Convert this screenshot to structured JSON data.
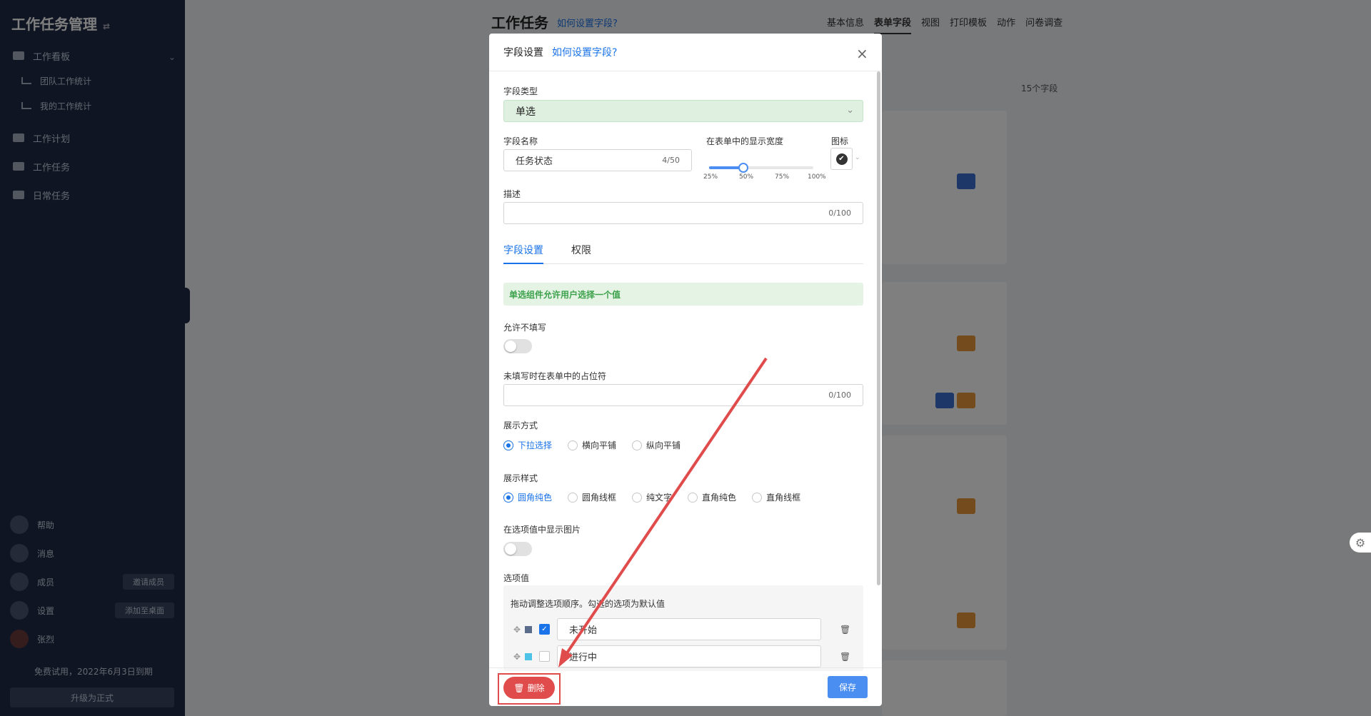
{
  "sidebar": {
    "title": "工作任务管理",
    "title_swap_icon": "⇄",
    "group_label": "工作看板",
    "sub_items": [
      "团队工作统计",
      "我的工作统计"
    ],
    "items": [
      "工作计划",
      "工作任务",
      "日常任务"
    ],
    "bottom_items": [
      {
        "label": "帮助",
        "pill": ""
      },
      {
        "label": "消息",
        "pill": ""
      },
      {
        "label": "成员",
        "pill": "邀请成员"
      },
      {
        "label": "设置",
        "pill": "添加至桌面"
      },
      {
        "label": "张烈",
        "pill": ""
      }
    ],
    "trial_text": "免费试用，2022年6月3日到期",
    "upgrade_button": "升级为正式"
  },
  "main": {
    "title": "工作任务",
    "help_link": "如何设置字段?",
    "tabs": [
      "基本信息",
      "表单字段",
      "视图",
      "打印模板",
      "动作",
      "问卷调查"
    ],
    "active_tab": "表单字段",
    "field_count": "15个字段"
  },
  "modal": {
    "title": "字段设置",
    "help_link": "如何设置字段?",
    "close_icon": "×",
    "field_type_label": "字段类型",
    "field_type_value": "单选",
    "field_name_label": "字段名称",
    "field_name_value": "任务状态",
    "field_name_count": "4/50",
    "width_label": "在表单中的显示宽度",
    "width_ticks": [
      "25%",
      "50%",
      "75%",
      "100%"
    ],
    "width_value": 0.5,
    "icon_label": "图标",
    "desc_label": "描述",
    "desc_count": "0/100",
    "tabs": [
      "字段设置",
      "权限"
    ],
    "info_text": "单选组件允许用户选择一个值",
    "allow_empty_label": "允许不填写",
    "allow_empty_on": false,
    "placeholder_label": "未填写时在表单中的占位符",
    "placeholder_count": "0/100",
    "display_mode_label": "展示方式",
    "display_modes": [
      "下拉选择",
      "横向平铺",
      "纵向平铺"
    ],
    "display_mode_selected": 0,
    "display_style_label": "展示样式",
    "display_styles": [
      "圆角纯色",
      "圆角线框",
      "纯文字",
      "直角纯色",
      "直角线框"
    ],
    "display_style_selected": 0,
    "show_image_label": "在选项值中显示图片",
    "show_image_on": false,
    "options_label": "选项值",
    "options_hint": "拖动调整选项顺序。勾选的选项为默认值",
    "options": [
      {
        "value": "未开始",
        "color": "#5b6b8c",
        "checked": true
      },
      {
        "value": "进行中",
        "color": "#4fc3e6",
        "checked": false
      }
    ],
    "delete_button": "删除",
    "save_button": "保存"
  },
  "colors": {
    "accent": "#1a73e8",
    "danger": "#e04b4b",
    "sidebar_bg": "#1f2a44",
    "success_bg": "#e5f3e5"
  }
}
